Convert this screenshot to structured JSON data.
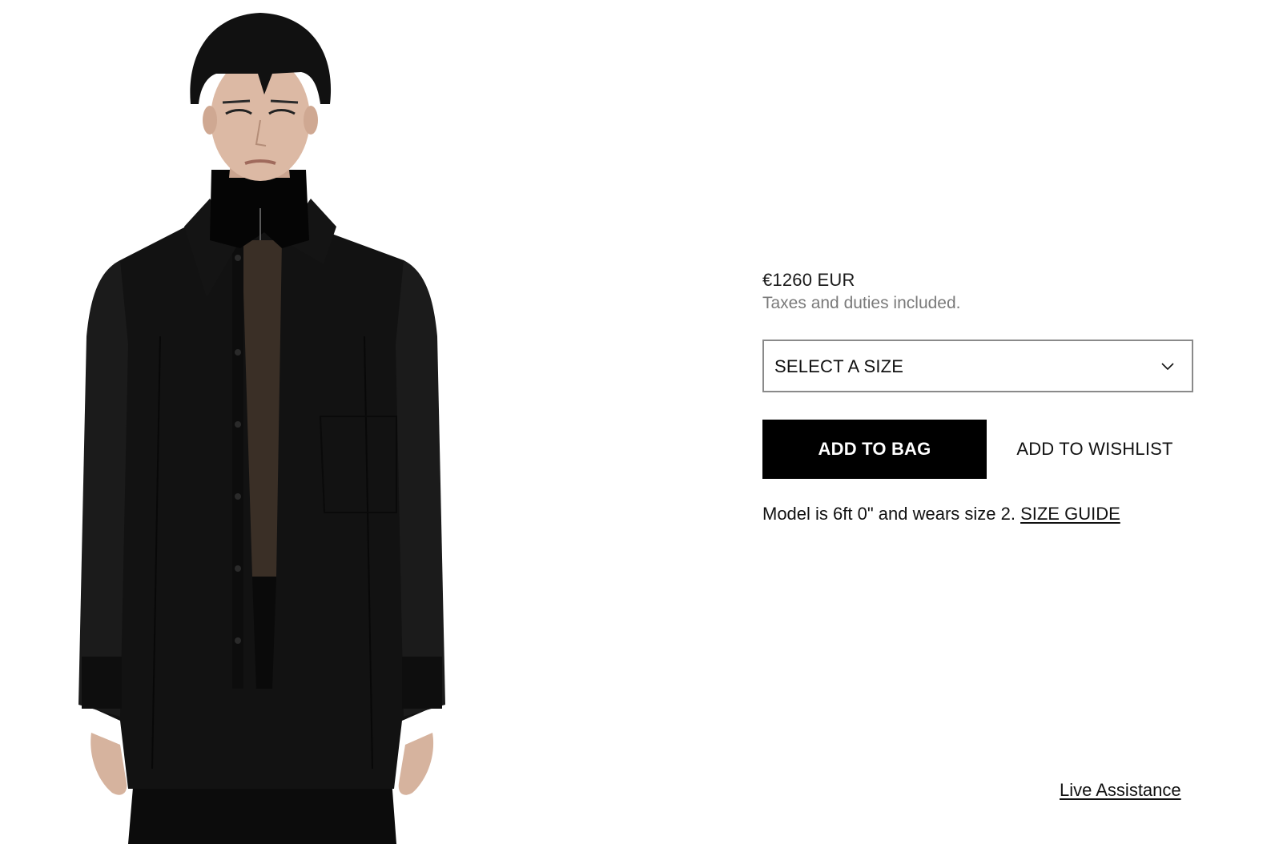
{
  "product": {
    "image_alt": "Model wearing black oversized shirt",
    "price": "€1260 EUR",
    "tax_note": "Taxes and duties included.",
    "size_select_label": "SELECT A SIZE",
    "add_to_bag_label": "ADD TO BAG",
    "add_to_wishlist_label": "ADD TO WISHLIST",
    "model_note_text": "Model is 6ft 0\" and wears size 2. ",
    "size_guide_label": "SIZE GUIDE"
  },
  "support": {
    "live_assistance_label": "Live Assistance"
  },
  "icons": {
    "size_select": "chevron-down-icon"
  },
  "colors": {
    "primary_button_bg": "#000000",
    "primary_button_text": "#ffffff",
    "muted_text": "#7a7a7a",
    "select_border": "#8a8a8a"
  }
}
